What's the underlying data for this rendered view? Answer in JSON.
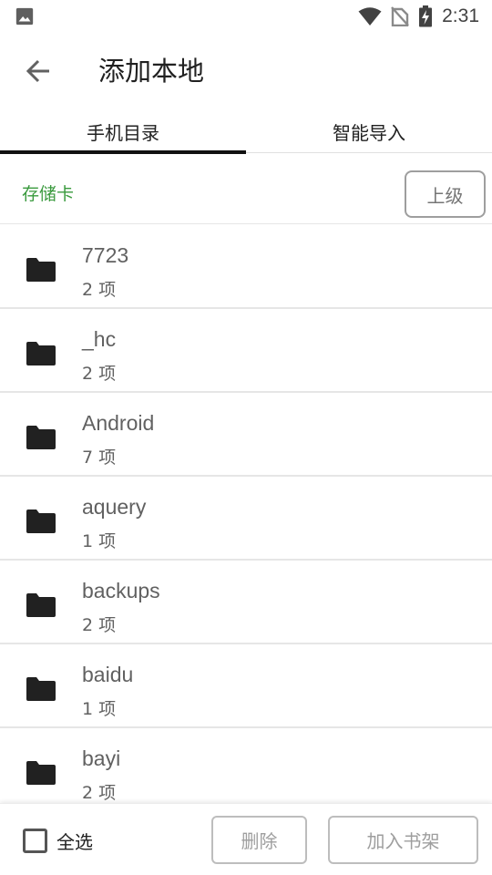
{
  "status_bar": {
    "time": "2:31",
    "icons": [
      "image-notification-icon",
      "wifi-icon",
      "no-sim-icon",
      "battery-charging-icon"
    ]
  },
  "toolbar": {
    "title": "添加本地",
    "back_icon": "arrow-left-icon"
  },
  "tabs": [
    {
      "label": "手机目录",
      "active": true
    },
    {
      "label": "智能导入",
      "active": false
    }
  ],
  "path": {
    "current": "存储卡",
    "up_label": "上级"
  },
  "files": [
    {
      "name": "7723",
      "count": "2 项"
    },
    {
      "name": "_hc",
      "count": "2 项"
    },
    {
      "name": "Android",
      "count": "7 项"
    },
    {
      "name": "aquery",
      "count": "1 项"
    },
    {
      "name": "backups",
      "count": "2 项"
    },
    {
      "name": "baidu",
      "count": "1 项"
    },
    {
      "name": "bayi",
      "count": "2 项"
    }
  ],
  "bottom": {
    "select_all_label": "全选",
    "delete_label": "删除",
    "add_label": "加入书架"
  },
  "colors": {
    "accent_green": "#3a9a3e",
    "tab_indicator": "#111111",
    "folder": "#212121"
  }
}
